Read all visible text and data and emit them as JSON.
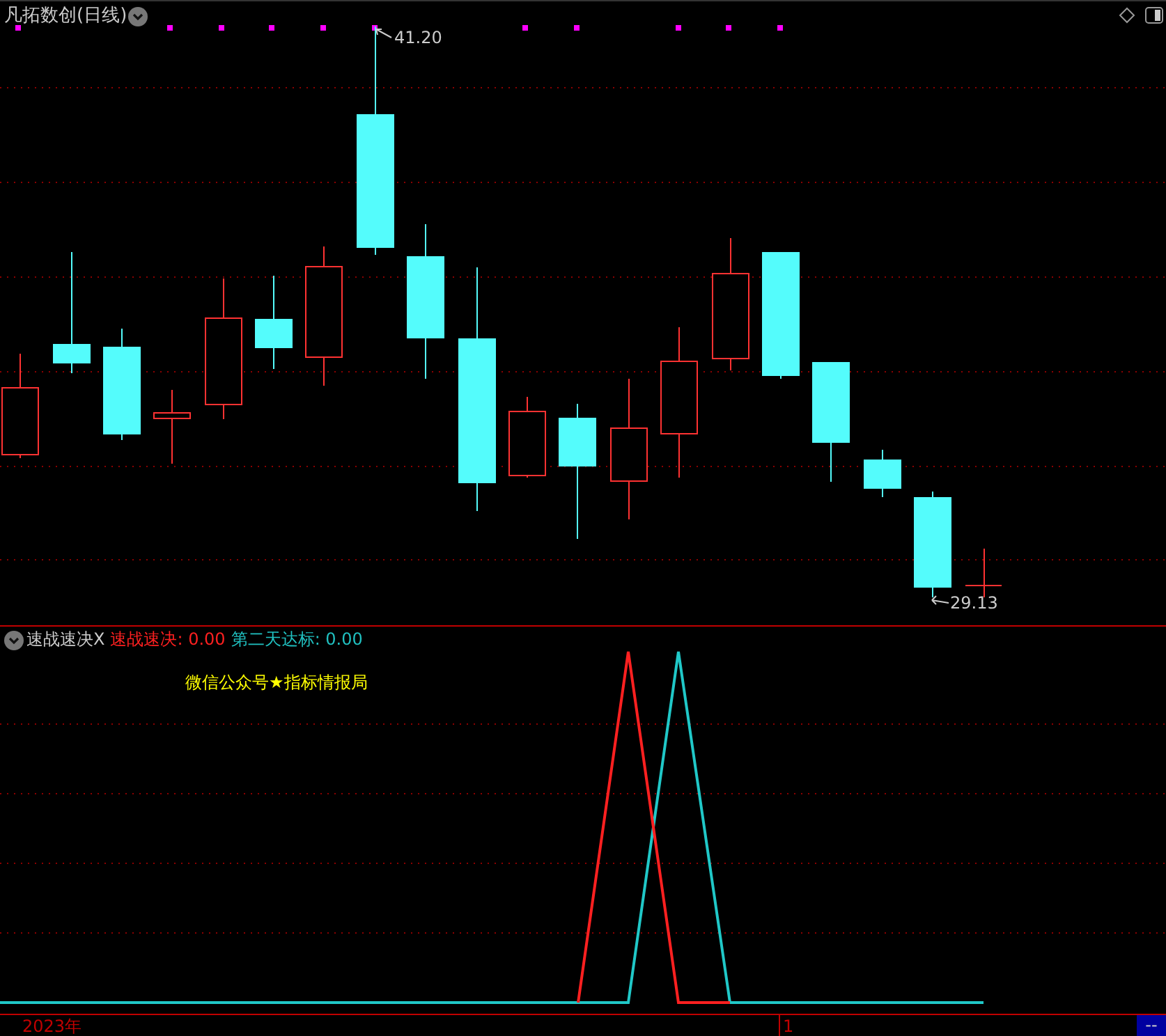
{
  "main_panel": {
    "title": "凡拓数创(日线)",
    "high_label": "41.20",
    "low_label": "29.13"
  },
  "indicator_panel": {
    "name": "速战速决X",
    "readouts": [
      {
        "label": "速战速决: 0.00",
        "color": "#ff2020"
      },
      {
        "label": "第二天达标: 0.00",
        "color": "#20c0c0"
      }
    ],
    "note": "微信公众号★指标情报局"
  },
  "time_axis": {
    "labels": [
      "2023年",
      "1"
    ],
    "corner": "--"
  }
}
